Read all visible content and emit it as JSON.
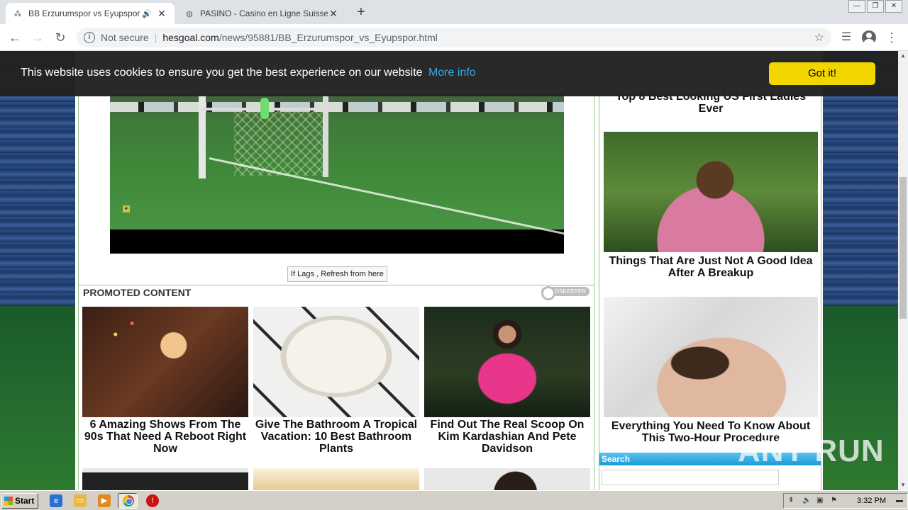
{
  "browser": {
    "tabs": [
      {
        "title": "BB Erzurumspor vs Eyupspor - H",
        "active": true
      },
      {
        "title": "PASINO - Casino en Ligne Suisse - Su",
        "active": false
      }
    ],
    "address": {
      "security": "Not secure",
      "host": "hesgoal.com",
      "path": "/news/95881/BB_Erzurumspor_vs_Eyupspor.html"
    }
  },
  "cookie_banner": {
    "message": "This website uses cookies to ensure you get the best experience on our website",
    "more_link": "More info",
    "accept_label": "Got it!"
  },
  "player": {
    "refresh_label": "If Lags , Refresh from here"
  },
  "promoted": {
    "title": "PROMOTED CONTENT",
    "provider": "ADSKEEPER",
    "cards": [
      {
        "caption": "6 Amazing Shows From The 90s That Need A Reboot Right Now"
      },
      {
        "caption": "Give The Bathroom A Tropical Vacation: 10 Best Bathroom Plants"
      },
      {
        "caption": "Find Out The Real Scoop On Kim Kardashian And Pete Davidson"
      }
    ]
  },
  "sidebar": {
    "cards": [
      {
        "caption": "Top 8 Best Looking US First Ladies Ever"
      },
      {
        "caption": "Things That Are Just Not A Good Idea After A Breakup"
      },
      {
        "caption": "Everything You Need To Know About This Two-Hour Procedure"
      }
    ],
    "search_label": "Search"
  },
  "watermark": "ANY RUN",
  "taskbar": {
    "start_label": "Start",
    "clock": "3:32 PM"
  }
}
